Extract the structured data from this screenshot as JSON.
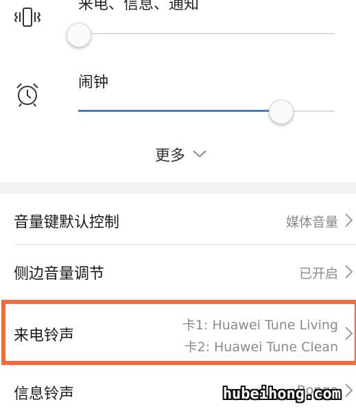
{
  "volume": {
    "ring": {
      "label": "来电、信息、通知",
      "icon": "vibrate-icon",
      "level": 0.0
    },
    "alarm": {
      "label": "闹钟",
      "icon": "alarm-clock-icon",
      "level": 0.79
    },
    "more_label": "更多",
    "accent_color": "#3d7fc1"
  },
  "settings": [
    {
      "label": "音量键默认控制",
      "value": "媒体音量"
    },
    {
      "label": "侧边音量调节",
      "value": "已开启"
    },
    {
      "label": "来电铃声",
      "value_line1": "卡1: Huawei Tune Living",
      "value_line2": "卡2: Huawei Tune Clean"
    },
    {
      "label": "信息铃声",
      "value": "Bongo"
    }
  ],
  "highlight_color": "#f26b3a",
  "watermark": "hubeihong.com"
}
